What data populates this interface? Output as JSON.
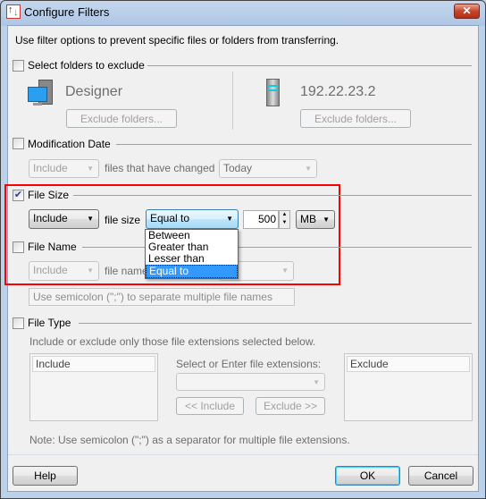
{
  "window": {
    "title": "Configure Filters",
    "close": "✕"
  },
  "intro": "Use filter options to prevent specific files or folders from transferring.",
  "folders": {
    "label": "Select folders to exclude",
    "checked": false,
    "local_name": "Designer",
    "remote_name": "192.22.23.2",
    "exclude_button": "Exclude folders..."
  },
  "mod_date": {
    "label": "Modification Date",
    "checked": false,
    "mode": "Include",
    "text": "files that have changed",
    "period": "Today"
  },
  "file_size": {
    "label": "File Size",
    "checked": true,
    "mode": "Include",
    "text": "file size",
    "comparison": "Equal to",
    "value": "500",
    "unit": "MB",
    "options": [
      "Between",
      "Greater than",
      "Lesser than",
      "Equal to"
    ],
    "selected_option": "Equal to"
  },
  "file_name": {
    "label": "File Name",
    "checked": false,
    "mode": "Include",
    "text": "file name",
    "placeholder": "Use semicolon (\";\") to separate multiple file names"
  },
  "file_type": {
    "label": "File Type",
    "checked": false,
    "description": "Include or exclude only those file extensions selected below.",
    "include_header": "Include",
    "exclude_header": "Exclude",
    "select_label": "Select or Enter file extensions:",
    "include_button": "<< Include",
    "exclude_button": "Exclude >>",
    "note": "Note: Use semicolon (\";\") as a separator for multiple file extensions."
  },
  "footer": {
    "help": "Help",
    "ok": "OK",
    "cancel": "Cancel"
  },
  "colors": {
    "highlight": "#ff0000",
    "selection": "#3399ff"
  }
}
